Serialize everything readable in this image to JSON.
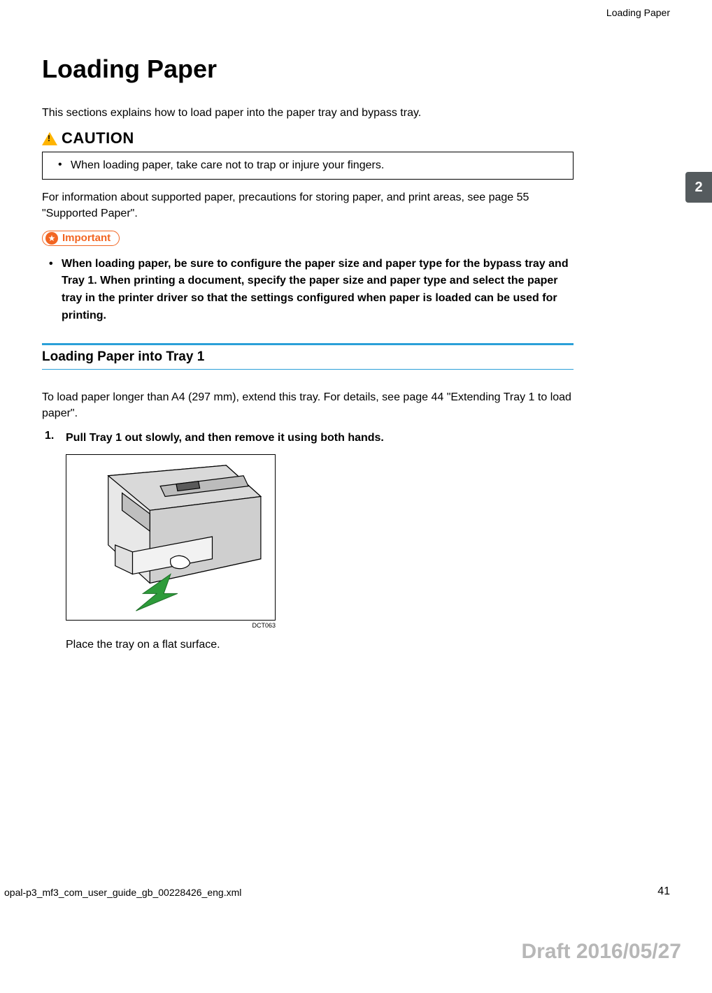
{
  "running_head": "Loading Paper",
  "title": "Loading Paper",
  "intro": "This sections explains how to load paper into the paper tray and bypass tray.",
  "caution_label": "CAUTION",
  "caution_item": "When loading paper, take care not to trap or injure your fingers.",
  "after_caution": "For information about supported paper, precautions for storing paper, and print areas, see page 55 \"Supported Paper\".",
  "important_label": "Important",
  "important_item": "When loading paper, be sure to configure the paper size and paper type for the bypass tray and Tray 1. When printing a document, specify the paper size and paper type and select the paper tray in the printer driver so that the settings configured when paper is loaded can be used for printing.",
  "section": {
    "title": "Loading Paper into Tray 1",
    "lead": "To load paper longer than A4 (297 mm), extend this tray. For details, see page 44 \"Extending Tray 1 to load paper\"."
  },
  "steps": [
    {
      "num": "1.",
      "text": "Pull Tray 1 out slowly, and then remove it using both hands.",
      "figure_id": "DCT063",
      "sub": "Place the tray on a flat surface."
    }
  ],
  "side_tab": "2",
  "footer": {
    "file": "opal-p3_mf3_com_user_guide_gb_00228426_eng.xml",
    "page": "41"
  },
  "draft": "Draft 2016/05/27"
}
